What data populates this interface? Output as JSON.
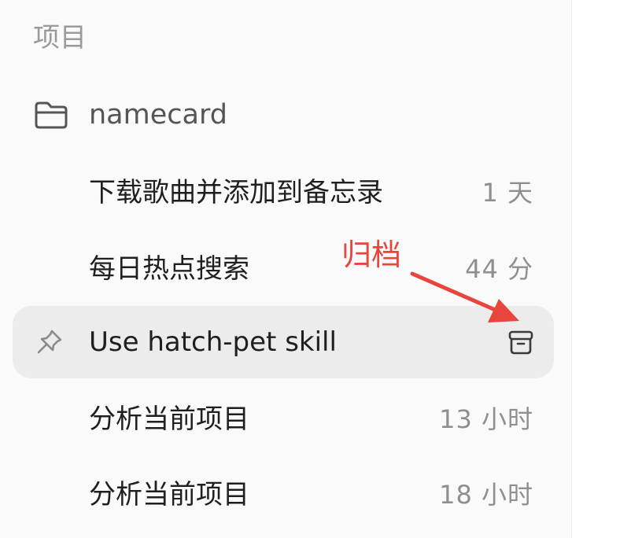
{
  "sidebar": {
    "section_title": "项目",
    "project": {
      "name": "namecard",
      "icon": "folder-icon"
    },
    "threads": [
      {
        "title": "下载歌曲并添加到备忘录",
        "time": "1 天"
      },
      {
        "title": "每日热点搜索",
        "time": "44 分"
      },
      {
        "title": "Use hatch-pet skill",
        "pinned": true,
        "active": true,
        "action_icon": "archive-icon"
      },
      {
        "title": "分析当前项目",
        "time": "13 小时"
      },
      {
        "title": "分析当前项目",
        "time": "18 小时"
      }
    ]
  },
  "annotation": {
    "text": "归档",
    "color": "#e8453c"
  }
}
